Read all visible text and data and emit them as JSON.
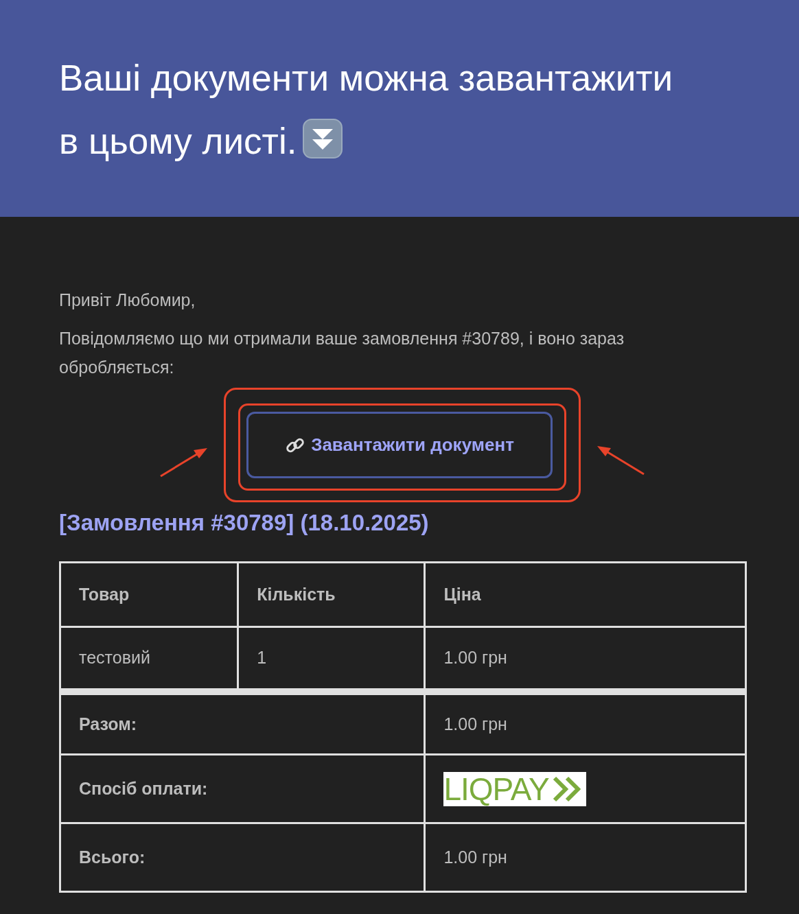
{
  "header": {
    "title": "Ваші документи можна завантажити в цьому листі."
  },
  "greeting": "Привіт Любомир,",
  "message": "Повідомляємо що ми отримали ваше замовлення #30789, і воно зараз обробляється:",
  "download_button": {
    "label": "Завантажити документ"
  },
  "order_heading": "[Замовлення #30789] (18.10.2025)",
  "table": {
    "columns": [
      "Товар",
      "Кількість",
      "Ціна"
    ],
    "rows": [
      [
        "тестовий",
        "1",
        "1.00 грн"
      ]
    ],
    "totals": [
      {
        "label": "Разом:",
        "kind": "text",
        "value": "1.00 грн"
      },
      {
        "label": "Спосіб оплати:",
        "kind": "logo",
        "value": "LIQPAY"
      },
      {
        "label": "Всього:",
        "kind": "text",
        "value": "1.00 грн"
      }
    ]
  }
}
